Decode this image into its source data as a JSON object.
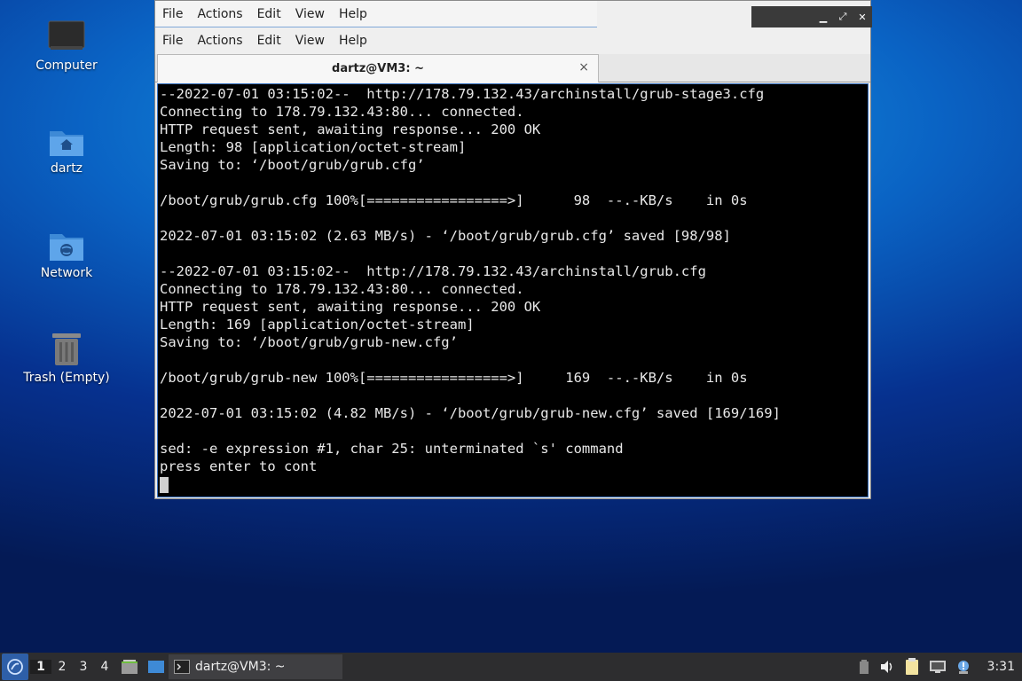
{
  "desktop": {
    "icons": [
      {
        "label": "Computer"
      },
      {
        "label": "dartz"
      },
      {
        "label": "Network"
      },
      {
        "label": "Trash (Empty)"
      }
    ]
  },
  "window": {
    "menu1": [
      "File",
      "Actions",
      "Edit",
      "View",
      "Help"
    ],
    "menu2": [
      "File",
      "Actions",
      "Edit",
      "View",
      "Help"
    ],
    "tab_title": "dartz@VM3: ~",
    "close_glyph": "×",
    "terminal_lines": [
      "--2022-07-01 03:15:02--  http://178.79.132.43/archinstall/grub-stage3.cfg",
      "Connecting to 178.79.132.43:80... connected.",
      "HTTP request sent, awaiting response... 200 OK",
      "Length: 98 [application/octet-stream]",
      "Saving to: ‘/boot/grub/grub.cfg’",
      "",
      "/boot/grub/grub.cfg 100%[=================>]      98  --.-KB/s    in 0s",
      "",
      "2022-07-01 03:15:02 (2.63 MB/s) - ‘/boot/grub/grub.cfg’ saved [98/98]",
      "",
      "--2022-07-01 03:15:02--  http://178.79.132.43/archinstall/grub.cfg",
      "Connecting to 178.79.132.43:80... connected.",
      "HTTP request sent, awaiting response... 200 OK",
      "Length: 169 [application/octet-stream]",
      "Saving to: ‘/boot/grub/grub-new.cfg’",
      "",
      "/boot/grub/grub-new 100%[=================>]     169  --.-KB/s    in 0s",
      "",
      "2022-07-01 03:15:02 (4.82 MB/s) - ‘/boot/grub/grub-new.cfg’ saved [169/169]",
      "",
      "sed: -e expression #1, char 25: unterminated `s' command",
      "press enter to cont"
    ]
  },
  "taskbar": {
    "workspaces": [
      "1",
      "2",
      "3",
      "4"
    ],
    "active_workspace": "1",
    "task_label": "dartz@VM3: ~",
    "clock": "3:31"
  },
  "colors": {
    "terminal_bg": "#000000",
    "terminal_fg": "#e8e8e8",
    "taskbar_bg": "#2d2d2f",
    "accent": "#3b74c2"
  }
}
